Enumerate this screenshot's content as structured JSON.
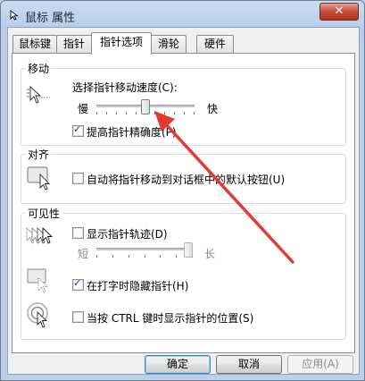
{
  "window": {
    "title": "鼠标 属性",
    "close_label": "✕"
  },
  "tabs": [
    {
      "label": "鼠标键"
    },
    {
      "label": "指针"
    },
    {
      "label": "指针选项",
      "active": true
    },
    {
      "label": "滑轮"
    },
    {
      "label": "硬件"
    }
  ],
  "motion": {
    "group_label": "移动",
    "speed_label": "选择指针移动速度(C):",
    "slow_label": "慢",
    "fast_label": "快",
    "speed_value": 0.5,
    "precision_label": "提高指针精确度(P)",
    "precision_checked": true
  },
  "snap": {
    "group_label": "对齐",
    "snap_label": "自动将指针移动到对话框中的默认按钮(U)",
    "snap_checked": false
  },
  "visibility": {
    "group_label": "可见性",
    "trails_label": "显示指针轨迹(D)",
    "trails_checked": false,
    "short_label": "短",
    "long_label": "长",
    "trail_length": 1.0,
    "hide_label": "在打字时隐藏指针(H)",
    "hide_checked": true,
    "ctrl_label": "当按 CTRL 键时显示指针的位置(S)",
    "ctrl_checked": false
  },
  "buttons": {
    "ok": "确定",
    "cancel": "取消",
    "apply": "应用(A)"
  },
  "colors": {
    "annotation_arrow": "#e53935",
    "title_bar": "#c9dcf1",
    "close_button": "#c74a38"
  }
}
